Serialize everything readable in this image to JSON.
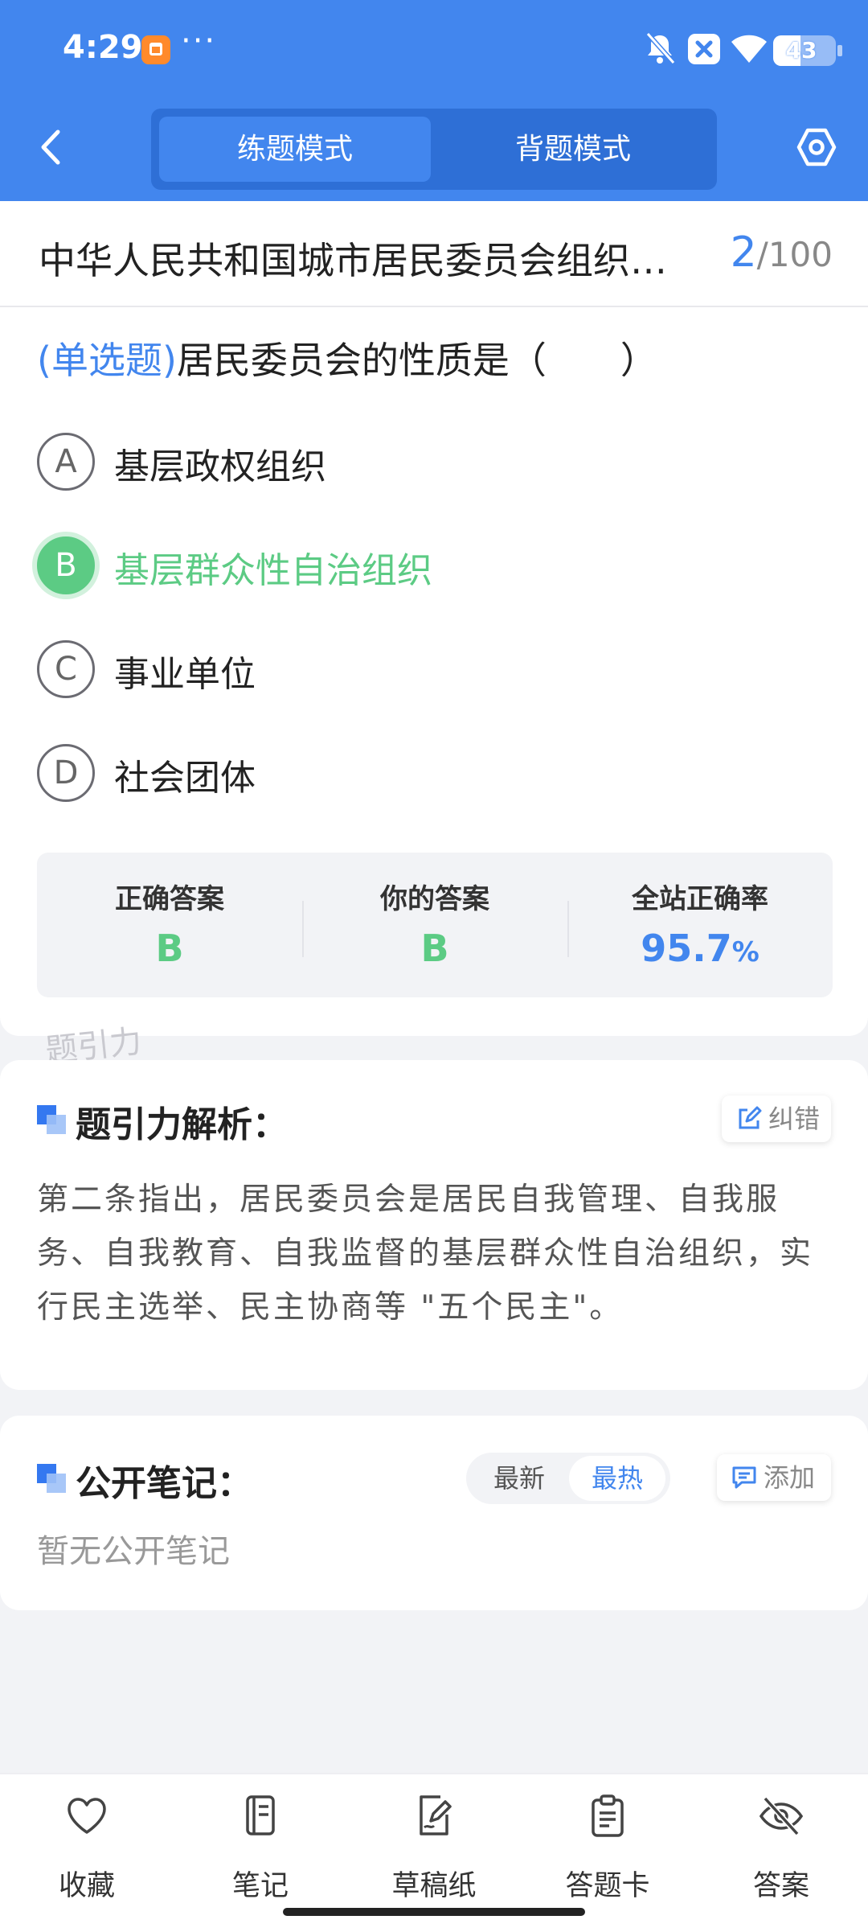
{
  "status_bar": {
    "time": "4:29",
    "overflow": "···",
    "battery_level": "43",
    "icons": [
      "app-notification-icon",
      "mute-icon",
      "sim-off-icon",
      "wifi-icon",
      "battery-icon"
    ]
  },
  "header": {
    "tabs": [
      "练题模式",
      "背题模式"
    ],
    "active_tab": "练题模式"
  },
  "title_bar": {
    "title": "中华人民共和国城市居民委员会组织…",
    "current": "2",
    "total": "/100"
  },
  "question": {
    "type": "(单选题)",
    "text": "居民委员会的性质是（　　）",
    "options": [
      {
        "letter": "A",
        "text": "基层政权组织"
      },
      {
        "letter": "B",
        "text": "基层群众性自治组织"
      },
      {
        "letter": "C",
        "text": "事业单位"
      },
      {
        "letter": "D",
        "text": "社会团体"
      }
    ],
    "selected": "B"
  },
  "answer_panel": {
    "correct_label": "正确答案",
    "correct_value": "B",
    "yours_label": "你的答案",
    "yours_value": "B",
    "rate_label": "全站正确率",
    "rate_value": "95.7",
    "rate_unit": "%"
  },
  "watermark": "题引力",
  "analysis": {
    "title": "题引力解析：",
    "report_label": "纠错",
    "text": "第二条指出，居民委员会是居民自我管理、自我服务、自我教育、自我监督的基层群众性自治组织，实行民主选举、民主协商等 \"五个民主\"。"
  },
  "notes": {
    "title": "公开笔记：",
    "sort_options": [
      "最新",
      "最热"
    ],
    "active_sort": "最热",
    "add_label": "添加",
    "empty_text": "暂无公开笔记"
  },
  "tabbar": {
    "items": [
      {
        "label": "收藏",
        "icon": "heart-icon"
      },
      {
        "label": "笔记",
        "icon": "notebook-icon"
      },
      {
        "label": "草稿纸",
        "icon": "draft-icon"
      },
      {
        "label": "答题卡",
        "icon": "clipboard-icon"
      },
      {
        "label": "答案",
        "icon": "eye-off-icon"
      }
    ]
  },
  "colors": {
    "primary": "#4286ee",
    "correct": "#5ccb84",
    "background": "#f2f3f6"
  }
}
